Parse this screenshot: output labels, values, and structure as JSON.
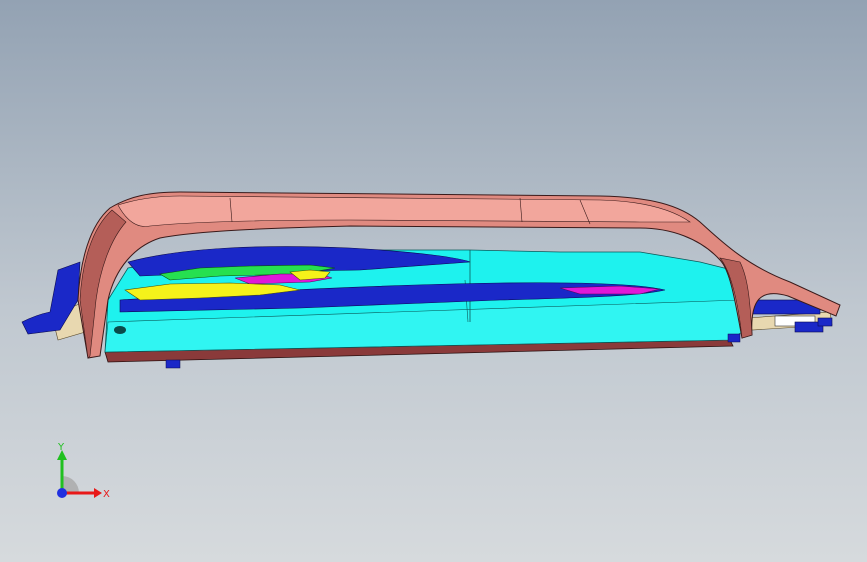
{
  "viewport": {
    "background_top": "#93a2b3",
    "background_bottom": "#d6dadd"
  },
  "model": {
    "parts": [
      {
        "name": "outer-frame",
        "color": "#e08a80"
      },
      {
        "name": "base-block",
        "color": "#1ef2ee"
      },
      {
        "name": "inner-blue-layer",
        "color": "#1a28c8"
      },
      {
        "name": "yellow-insert",
        "color": "#f5f21a"
      },
      {
        "name": "magenta-insert",
        "color": "#e018d8"
      },
      {
        "name": "green-insert",
        "color": "#26e050"
      },
      {
        "name": "tan-insert",
        "color": "#e8d8b0"
      }
    ]
  },
  "triad": {
    "x_label": "X",
    "y_label": "Y",
    "x_color": "#e81818",
    "y_color": "#20c020",
    "origin_color": "#2030e0"
  }
}
